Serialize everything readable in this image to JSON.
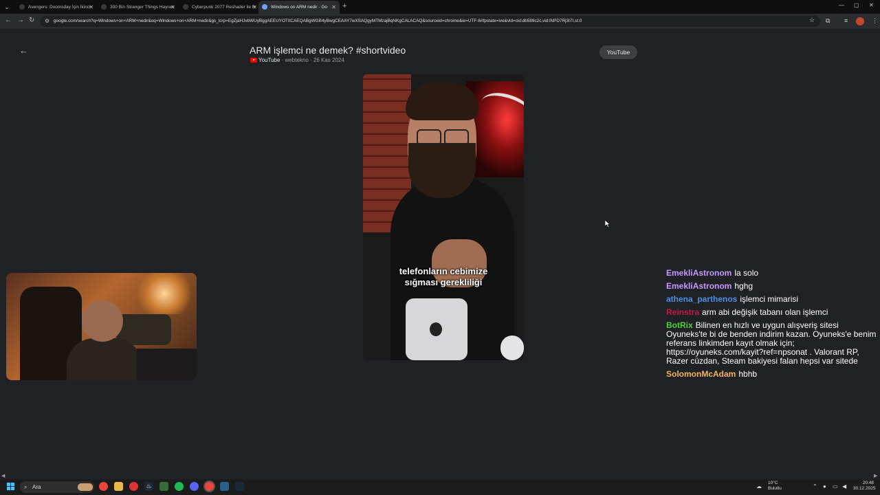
{
  "browser": {
    "tabs": [
      {
        "title": "Avengers: Doomsday İçin İkinci"
      },
      {
        "title": "300 Bin Stranger Things Hayran"
      },
      {
        "title": "Cyberpunk 2077 Reshader ile B"
      },
      {
        "title": "Windows on ARM nedir - Go"
      }
    ],
    "url": "google.com/search?q=Windows+on+ARM+nedir&oq=Windows+on+ARM+nedir&gs_lcrp=EgZjaHJvbWUyBggAEEUYOTIICAEQABgWGB4yBwgCEAAY7wXSAQgyMTMzajBqNKgCALACAQ&sourceid=chrome&ie=UTF-8#fpstate=ive&vld=cid:db589c2c,vid:lNPD7Rj3I7I,st:0"
  },
  "result": {
    "title": "ARM işlemci ne demek? #shortvideo",
    "source": "YouTube",
    "channel": "webtekno",
    "date": "26 Kas 2024",
    "open_button": "YouTube"
  },
  "video": {
    "caption_line1": "telefonların cebimize",
    "caption_line2": "sığması gerekliliği"
  },
  "chat": {
    "messages": [
      {
        "user": "EmekliAstronom",
        "text": "la solo",
        "color": "#c59aff"
      },
      {
        "user": "EmekliAstronom",
        "text": "hghg",
        "color": "#c59aff"
      },
      {
        "user": "athena_parthenos",
        "text": "işlemci mimarisi",
        "color": "#4a90e2"
      },
      {
        "user": "Reinstra",
        "text": "arm abi değişik tabanı olan işlemci",
        "color": "#c8154a"
      },
      {
        "user": "BotRix",
        "text": "Bilinen en hızlı ve uygun alışveriş sitesi Oyuneks'te bi de benden indirim kazan. Oyuneks'e benim referans linkimden kayıt olmak için; https://oyuneks.com/kayit?ref=npsonat . Valorant RP, Razer cüzdan, Steam bakiyesi falan hepsi var sitede",
        "color": "#4cd137"
      },
      {
        "user": "SolomonMcAdam",
        "text": "hbhb",
        "color": "#f4b35f"
      }
    ]
  },
  "taskbar": {
    "search_placeholder": "Ara",
    "weather_temp": "10°C",
    "weather_desc": "Bulutlu",
    "time": "20:48",
    "date": "30.12.2025"
  }
}
